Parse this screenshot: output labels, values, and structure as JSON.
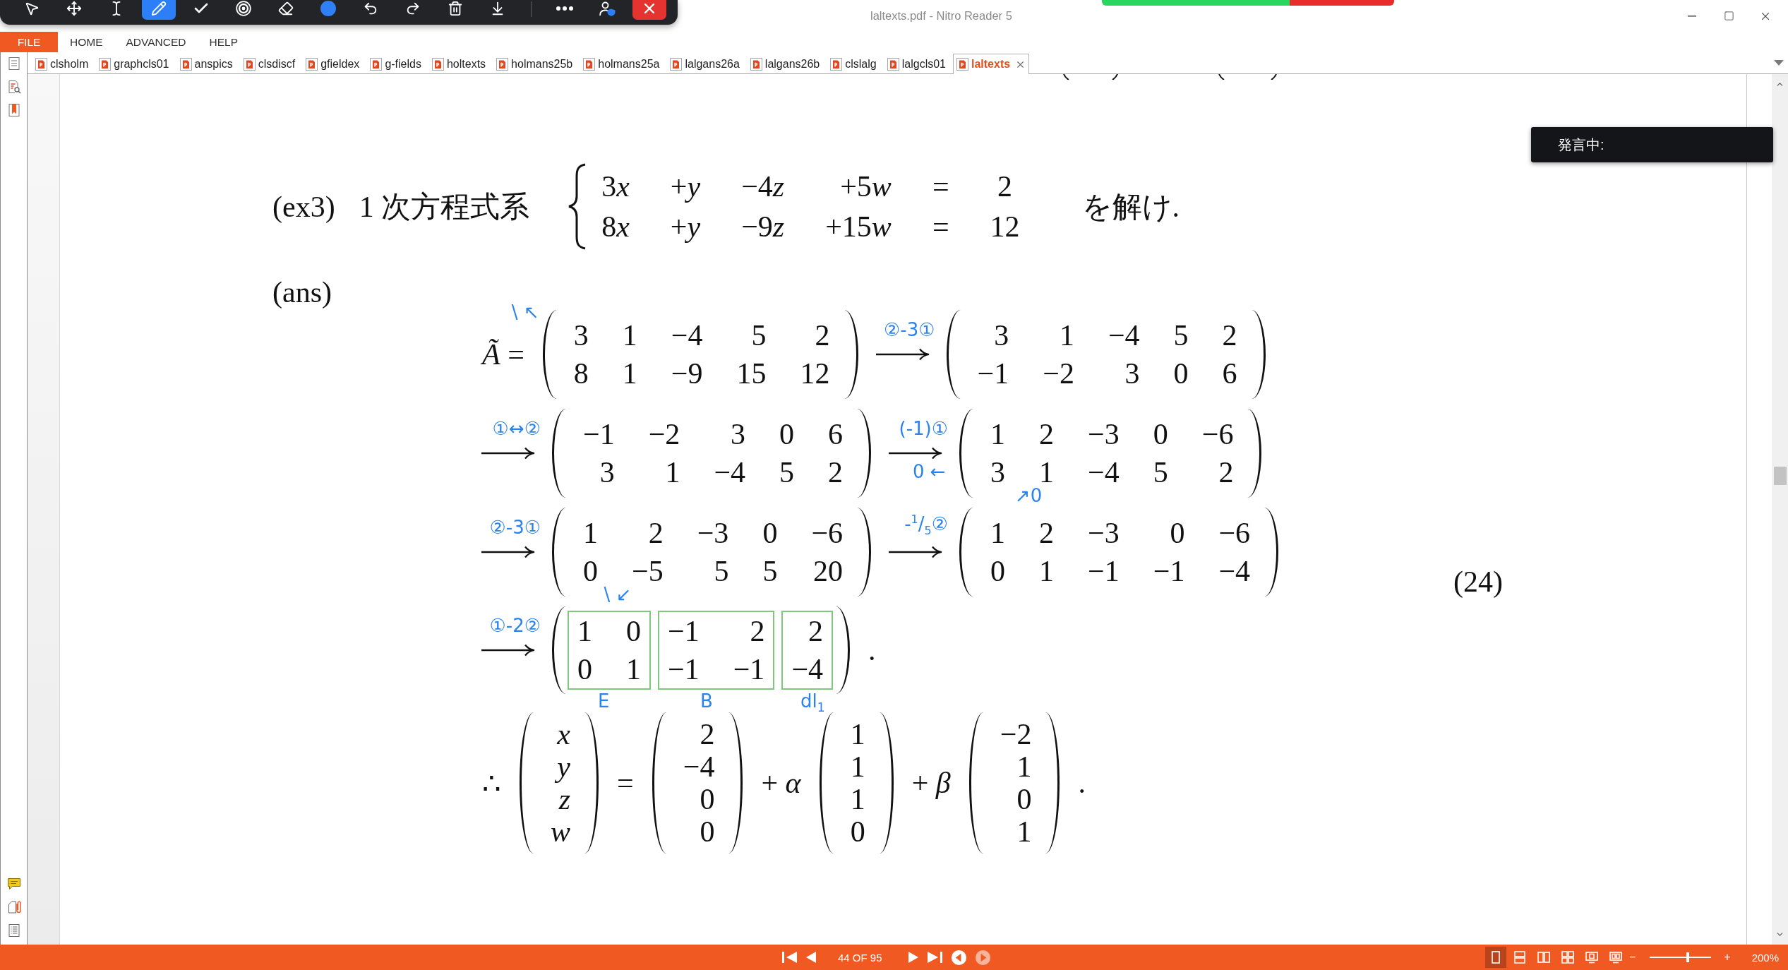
{
  "window": {
    "title": "laltexts.pdf - Nitro Reader 5"
  },
  "annotation_toolbar": {
    "tools": [
      {
        "kind": "pointer",
        "selected": false
      },
      {
        "kind": "move",
        "selected": false
      },
      {
        "kind": "text",
        "selected": false
      },
      {
        "kind": "pen",
        "selected": true
      },
      {
        "kind": "check",
        "selected": false
      },
      {
        "kind": "stamp",
        "selected": false
      },
      {
        "kind": "eraser",
        "selected": false
      },
      {
        "kind": "color",
        "selected": false,
        "color": "#2f80f7"
      },
      {
        "kind": "undo",
        "selected": false
      },
      {
        "kind": "redo",
        "selected": false
      },
      {
        "kind": "delete",
        "selected": false
      },
      {
        "kind": "download",
        "selected": false
      },
      {
        "kind": "more",
        "selected": false
      },
      {
        "kind": "user",
        "selected": false
      },
      {
        "kind": "close",
        "selected": false
      }
    ]
  },
  "menu": {
    "file": "FILE",
    "items": [
      "HOME",
      "ADVANCED",
      "HELP"
    ]
  },
  "document_tabs": [
    {
      "label": "clsholm",
      "selected": false
    },
    {
      "label": "graphcls01",
      "selected": false
    },
    {
      "label": "anspics",
      "selected": false
    },
    {
      "label": "clsdiscf",
      "selected": false
    },
    {
      "label": "gfieldex",
      "selected": false
    },
    {
      "label": "g-fields",
      "selected": false
    },
    {
      "label": "holtexts",
      "selected": false
    },
    {
      "label": "holmans25b",
      "selected": false
    },
    {
      "label": "holmans25a",
      "selected": false
    },
    {
      "label": "lalgans26a",
      "selected": false
    },
    {
      "label": "lalgans26b",
      "selected": false
    },
    {
      "label": "clslalg",
      "selected": false
    },
    {
      "label": "lalgcls01",
      "selected": false
    },
    {
      "label": "laltexts",
      "selected": true
    }
  ],
  "page": {
    "problem": {
      "label": "(ex3)",
      "intro": "1 次方程式系",
      "system": [
        {
          "terms": [
            {
              "coef": "3",
              "var": "x"
            },
            {
              "coef": "+",
              "var": "y"
            },
            {
              "coef": "−4",
              "var": "z"
            },
            {
              "coef": "+5",
              "var": "w"
            }
          ],
          "relation": "=",
          "rhs": "2"
        },
        {
          "terms": [
            {
              "coef": "8",
              "var": "x"
            },
            {
              "coef": "+",
              "var": "y"
            },
            {
              "coef": "−9",
              "var": "z"
            },
            {
              "coef": "+15",
              "var": "w"
            }
          ],
          "relation": "=",
          "rhs": "12"
        }
      ],
      "closing": "を解け."
    },
    "answer_label": "(ans)",
    "derivation": [
      {
        "parts": [
          {
            "kind": "symbol",
            "text": "*Ã* ="
          },
          {
            "kind": "matrix",
            "rows": [
              [
                "3",
                "1",
                "−4",
                "5",
                "2"
              ],
              [
                "8",
                "1",
                "−9",
                "15",
                "12"
              ]
            ],
            "ink": {
              "kind": "corner",
              "text": "\\ ↖"
            }
          },
          {
            "kind": "step",
            "ink": "②-3①"
          },
          {
            "kind": "matrix",
            "rows": [
              [
                "3",
                "1",
                "−4",
                "5",
                "2"
              ],
              [
                "−1",
                "−2",
                "3",
                "0",
                "6"
              ]
            ]
          }
        ]
      },
      {
        "parts": [
          {
            "kind": "step",
            "ink": "①↔②"
          },
          {
            "kind": "matrix",
            "rows": [
              [
                "−1",
                "−2",
                "3",
                "0",
                "6"
              ],
              [
                "3",
                "1",
                "−4",
                "5",
                "2"
              ]
            ]
          },
          {
            "kind": "step",
            "ink": "(-1)①"
          },
          {
            "kind": "matrix",
            "rows": [
              [
                "1",
                "2",
                "−3",
                "0",
                "−6"
              ],
              [
                "3",
                "1",
                "−4",
                "5",
                "2"
              ]
            ],
            "ink": {
              "kind": "beside",
              "text": "0 ←"
            }
          }
        ]
      },
      {
        "parts": [
          {
            "kind": "step",
            "ink": "②-3①"
          },
          {
            "kind": "matrix",
            "rows": [
              [
                "1",
                "2",
                "−3",
                "0",
                "−6"
              ],
              [
                "0",
                "−5",
                "5",
                "5",
                "20"
              ]
            ]
          },
          {
            "kind": "step",
            "ink": "-$^{1}$/$_{5}$②"
          },
          {
            "kind": "matrix",
            "rows": [
              [
                "1",
                "2",
                "−3",
                "0",
                "−6"
              ],
              [
                "0",
                "1",
                "−1",
                "−1",
                "−4"
              ]
            ],
            "ink": {
              "kind": "above",
              "text": "↗0"
            }
          }
        ]
      },
      {
        "parts": [
          {
            "kind": "step",
            "ink": "①-2②"
          },
          {
            "kind": "blocks",
            "ink": {
              "kind": "above",
              "text": "\\ ↙"
            },
            "blocks": [
              {
                "rows": [
                  [
                    "1",
                    "0"
                  ],
                  [
                    "0",
                    "1"
                  ]
                ],
                "ink": "E"
              },
              {
                "rows": [
                  [
                    "−1",
                    "2"
                  ],
                  [
                    "−1",
                    "−1"
                  ]
                ],
                "ink": "B"
              },
              {
                "rows": [
                  [
                    "2"
                  ],
                  [
                    "−4"
                  ]
                ],
                "ink": "dl$_{1}$"
              }
            ]
          },
          {
            "kind": "symbol",
            "text": "."
          }
        ]
      },
      {
        "parts": [
          {
            "kind": "symbol",
            "text": "∴"
          },
          {
            "kind": "variables",
            "rows": [
              [
                "x"
              ],
              [
                "y"
              ],
              [
                "z"
              ],
              [
                "w"
              ]
            ]
          },
          {
            "kind": "symbol",
            "text": "="
          },
          {
            "kind": "matrix",
            "rows": [
              [
                "2"
              ],
              [
                "−4"
              ],
              [
                "0"
              ],
              [
                "0"
              ]
            ]
          },
          {
            "kind": "symbol",
            "text": "+ *α*"
          },
          {
            "kind": "matrix",
            "rows": [
              [
                "1"
              ],
              [
                "1"
              ],
              [
                "1"
              ],
              [
                "0"
              ]
            ]
          },
          {
            "kind": "symbol",
            "text": "+ *β*"
          },
          {
            "kind": "matrix",
            "rows": [
              [
                "−2"
              ],
              [
                "1"
              ],
              [
                "0"
              ],
              [
                "1"
              ]
            ]
          },
          {
            "kind": "symbol",
            "text": "."
          }
        ]
      }
    ],
    "equation_number": "(24)"
  },
  "speech_popup": {
    "text": "発言中:"
  },
  "status_bar": {
    "navigation": [
      {
        "kind": "first",
        "disabled": false
      },
      {
        "kind": "previous",
        "disabled": false
      },
      {
        "kind": "next",
        "disabled": false
      },
      {
        "kind": "last",
        "disabled": false
      },
      {
        "kind": "back",
        "disabled": false
      },
      {
        "kind": "forward",
        "disabled": true
      }
    ],
    "page_indicator": "44 OF 95",
    "views": [
      {
        "kind": "single",
        "selected": true
      },
      {
        "kind": "continuous",
        "selected": false
      },
      {
        "kind": "facing",
        "selected": false
      },
      {
        "kind": "facing-continuous",
        "selected": false
      },
      {
        "kind": "screen",
        "selected": false
      },
      {
        "kind": "screen-facing",
        "selected": false
      }
    ],
    "zoom": {
      "out": "−",
      "in": "+",
      "level": 0.62,
      "reading": "200%"
    }
  }
}
